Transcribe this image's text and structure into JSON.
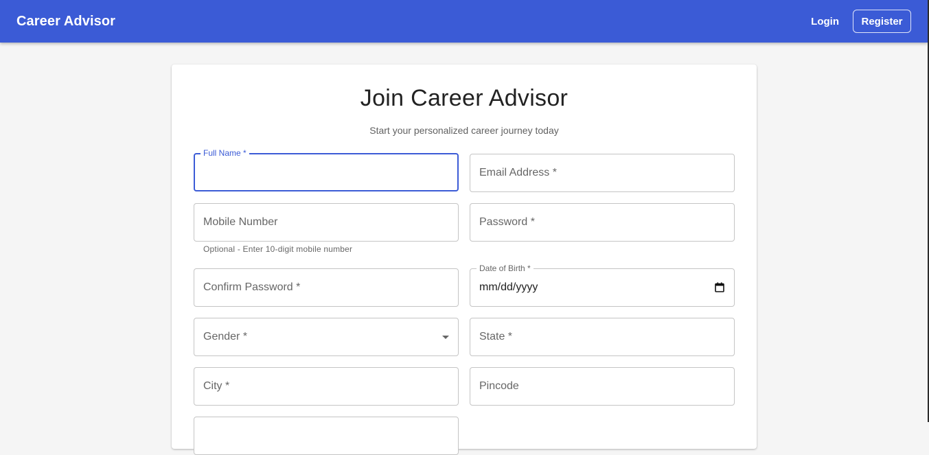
{
  "appbar": {
    "brand": "Career Advisor",
    "login_label": "Login",
    "register_label": "Register",
    "color": "#3b5bd6"
  },
  "form": {
    "title": "Join Career Advisor",
    "subtitle": "Start your personalized career journey today",
    "fields": {
      "full_name": {
        "label": "Full Name *",
        "value": ""
      },
      "email": {
        "label": "Email Address *"
      },
      "mobile": {
        "label": "Mobile Number",
        "helper": "Optional - Enter 10-digit mobile number"
      },
      "password": {
        "label": "Password *"
      },
      "confirm_password": {
        "label": "Confirm Password *"
      },
      "dob": {
        "label": "Date of Birth *",
        "value": "mm/dd/yyyy"
      },
      "gender": {
        "label": "Gender *"
      },
      "state": {
        "label": "State *"
      },
      "city": {
        "label": "City *"
      },
      "pincode": {
        "label": "Pincode"
      }
    }
  }
}
